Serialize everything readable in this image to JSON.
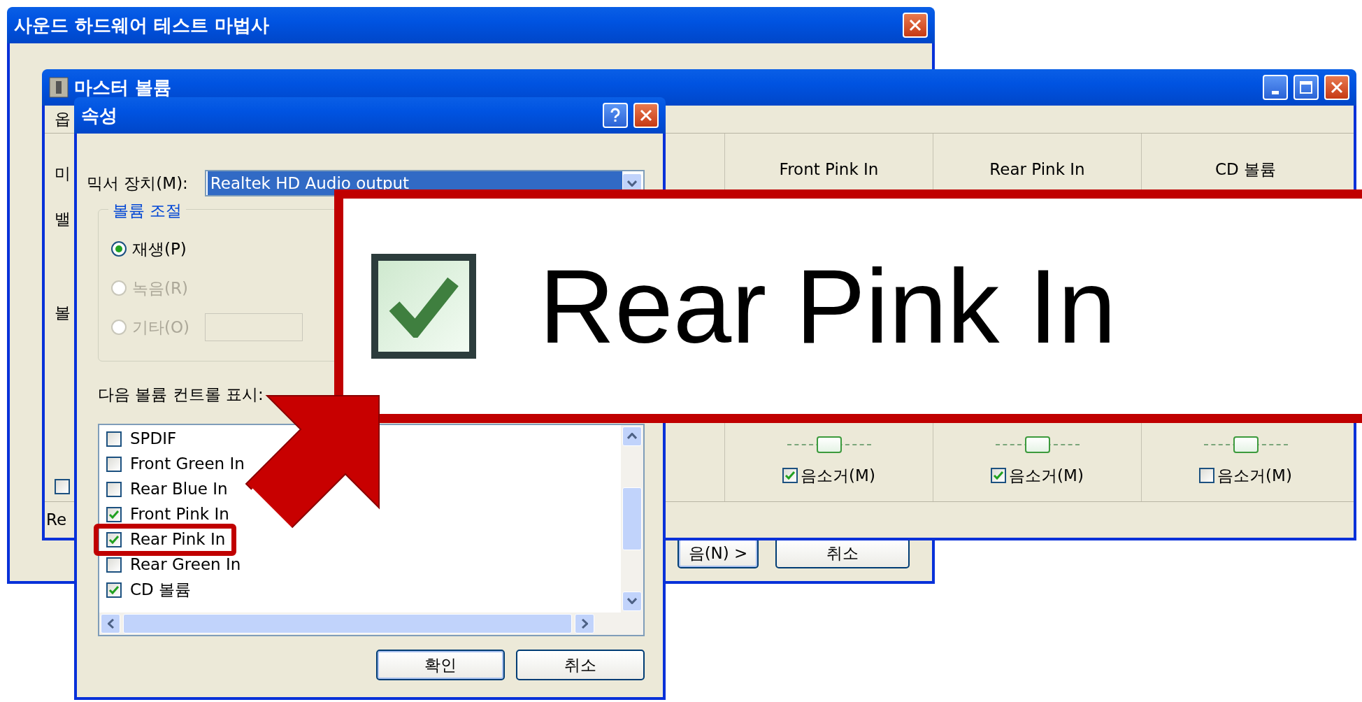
{
  "wizard_window": {
    "title": "사운드 하드웨어 테스트 마법사",
    "buttons": [
      {
        "label": "음(N) >",
        "kind": "default"
      },
      {
        "label": "취소",
        "kind": "normal"
      }
    ]
  },
  "master_volume_window": {
    "title": "마스터 볼륨",
    "menu_fragment": "옵",
    "label_fragments": [
      "미",
      "밸",
      "볼"
    ],
    "mute_fragment": {
      "checked": false
    },
    "status_fragment": "Re",
    "columns": [
      {
        "name": "Front Pink In",
        "level": 0.5,
        "mute_label": "음소거(M)",
        "muted": true
      },
      {
        "name": "Rear Pink In",
        "level": 0.5,
        "mute_label": "음소거(M)",
        "muted": true
      },
      {
        "name": "CD 볼륨",
        "level": 0.5,
        "mute_label": "음소거(M)",
        "muted": false
      }
    ]
  },
  "properties_dialog": {
    "title": "속성",
    "mixer_label": "믹서 장치(M):",
    "mixer_device": {
      "value": "Realtek HD Audio output",
      "focused": true
    },
    "group_label": "볼륨 조절",
    "radios": [
      {
        "label": "재생(P)",
        "selected": true,
        "disabled": false
      },
      {
        "label": "녹음(R)",
        "selected": false,
        "disabled": true
      },
      {
        "label": "기타(O)",
        "selected": false,
        "disabled": true
      }
    ],
    "list_label": "다음 볼륨 컨트롤 표시:",
    "controls": [
      {
        "label": "SPDIF",
        "checked": false,
        "highlighted": false
      },
      {
        "label": "Front Green In",
        "checked": false,
        "highlighted": false
      },
      {
        "label": "Rear Blue In",
        "checked": false,
        "highlighted": false
      },
      {
        "label": "Front Pink In",
        "checked": true,
        "highlighted": false
      },
      {
        "label": "Rear Pink In",
        "checked": true,
        "highlighted": true
      },
      {
        "label": "Rear Green In",
        "checked": false,
        "highlighted": false
      },
      {
        "label": "CD 볼륨",
        "checked": true,
        "highlighted": false
      }
    ],
    "buttons": [
      {
        "label": "확인",
        "kind": "default"
      },
      {
        "label": "취소",
        "kind": "normal"
      }
    ]
  },
  "callout": {
    "label": "Rear Pink In",
    "checked": true
  }
}
